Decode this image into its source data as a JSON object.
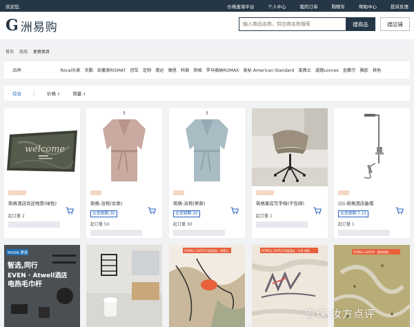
{
  "topbar": {
    "welcome": "欢迎您,",
    "links": [
      "价格查询平台",
      "个人中心",
      "我的订单",
      "购物车",
      "帮助中心",
      "投诉反馈"
    ]
  },
  "logo": {
    "mark": "G",
    "name": "洲易购"
  },
  "search": {
    "placeholder": "输入商品名称、供应商名称搜索",
    "goods_button": "搜商品",
    "store_button": "搜店铺"
  },
  "breadcrumb": [
    "首页",
    "商品",
    "更换类目"
  ],
  "brands": {
    "label": "品牌:",
    "items": [
      "Rocal乐家",
      "东鹏",
      "凯撒美RISMAT",
      "冠军",
      "定制",
      "惠达",
      "摩恩",
      "科勒",
      "筑格",
      "罗马德纳ROMAX",
      "美标 American Standard",
      "莱弗士",
      "道路Lonces",
      "金螺尔",
      "雅欧",
      "其他"
    ]
  },
  "sort": {
    "items": [
      "综合",
      "价格",
      "销量"
    ]
  },
  "products": [
    {
      "name": "筑格酒店欢迎地垫(绿色)",
      "badge": "",
      "moq": "起订量 2",
      "welcome_text": "welcome"
    },
    {
      "name": "筑格-浴袍(女款)",
      "badge": "交货周期:30",
      "moq": "起订量 50"
    },
    {
      "name": "筑格-浴袍(男款)",
      "badge": "交货周期:30",
      "moq": "起订量 30"
    },
    {
      "name": "筑格客房写字椅(不包邮)",
      "badge": "",
      "moq": "起订量 1"
    },
    {
      "name": "-筑格酒店备帽",
      "badge": "交货周期:7-15",
      "moq": "起订量 1"
    }
  ],
  "row2": {
    "moen_brand": "MOEN 摩恩",
    "moen_line1": "智选,同行",
    "moen_line2": "EVEN · Atwell酒店",
    "moen_line3": "电热毛巾杆",
    "atwell_tag": "ATWELL SUITES 阿维酒店 · 地毯元",
    "atwell_tag2": "ATWELL SUITES 阿维酒店 · 大堂 地毯",
    "atwell_tag3": "ATWELL SUITES · 客房地毯"
  },
  "watermark": "雪球:汝方点评",
  "colors": {
    "topbar": "#253746",
    "accent": "#1f5fbf",
    "blur_orange": "#f6d6c4"
  }
}
